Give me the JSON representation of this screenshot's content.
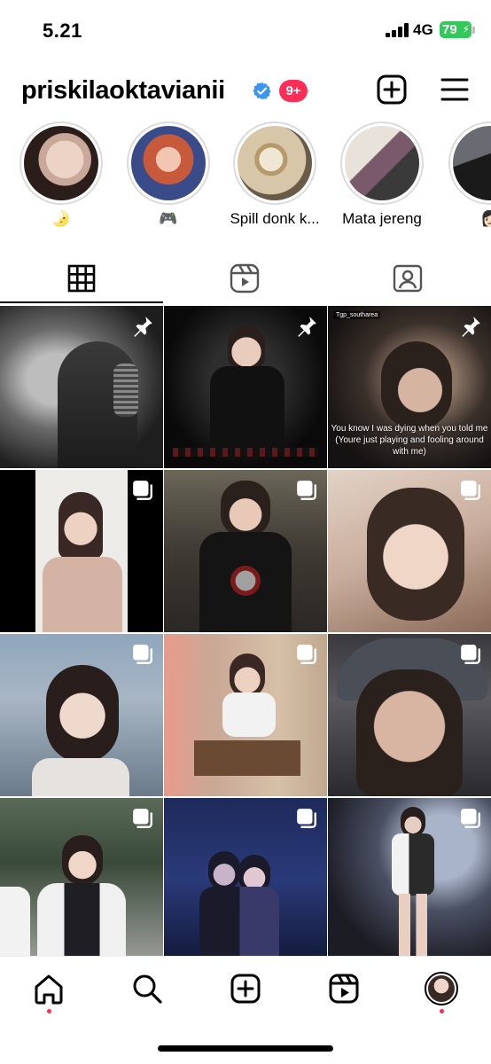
{
  "status_bar": {
    "time": "5.21",
    "network": "4G",
    "battery": "79"
  },
  "header": {
    "username": "priskilaoktavianii",
    "notification_count": "9+"
  },
  "highlights": [
    {
      "label": "🌛",
      "colors": [
        "#e8cfc3",
        "#2a1d1a"
      ]
    },
    {
      "label": "🎮",
      "colors": [
        "#c85a3c",
        "#3a4b8a"
      ]
    },
    {
      "label": "Spill donk k...",
      "colors": [
        "#d8c6a8",
        "#6a5a48"
      ]
    },
    {
      "label": "Mata jereng",
      "colors": [
        "#e8e2da",
        "#4a3a4a"
      ]
    },
    {
      "label": "👩🏻",
      "colors": [
        "#5a5a62",
        "#1a1a1a"
      ]
    }
  ],
  "tabs": [
    {
      "name": "posts-grid",
      "active": true
    },
    {
      "name": "reels",
      "active": false
    },
    {
      "name": "tagged",
      "active": false
    }
  ],
  "posts": [
    {
      "type": "pinned",
      "bg": "#2a2a2a",
      "accent": "#8a8a8a"
    },
    {
      "type": "pinned",
      "bg": "#0e0e0e",
      "accent": "#3a3a3a"
    },
    {
      "type": "pinned",
      "bg": "#2a2420",
      "accent": "#6a5548",
      "tag": "Tgp_southarea",
      "caption": "You know I was dying when you told me (Youre just playing and fooling around with me)"
    },
    {
      "type": "carousel",
      "bg": "#e8e4de",
      "accent": "#c9a898"
    },
    {
      "type": "carousel",
      "bg": "#3e3a34",
      "accent": "#1a1a1a"
    },
    {
      "type": "carousel",
      "bg": "#d9c4b4",
      "accent": "#8a6a58"
    },
    {
      "type": "carousel",
      "bg": "#8fa6bd",
      "accent": "#e6d6cc"
    },
    {
      "type": "carousel",
      "bg": "#c9a896",
      "accent": "#6a5a4a"
    },
    {
      "type": "carousel",
      "bg": "#4a4a4e",
      "accent": "#d2b0a0"
    },
    {
      "type": "carousel",
      "bg": "#5a6a58",
      "accent": "#2a2a2e"
    },
    {
      "type": "carousel",
      "bg": "#1e2a5a",
      "accent": "#4a6aaa"
    },
    {
      "type": "carousel",
      "bg": "#1c1c24",
      "accent": "#aab4c8"
    }
  ],
  "bottom_nav": [
    "home",
    "search",
    "create",
    "reels",
    "profile"
  ]
}
